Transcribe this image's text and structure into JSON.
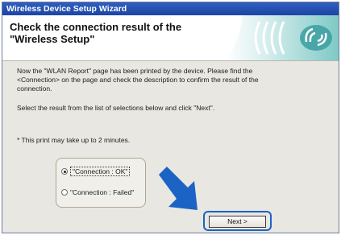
{
  "window": {
    "title": "Wireless Device Setup Wizard"
  },
  "header": {
    "title_line1": "Check the connection result of the",
    "title_line2": "\"Wireless Setup\""
  },
  "content": {
    "p1_line1": "Now the \"WLAN Report\" page has been printed by the device. Please find the",
    "p1_line2": "<Connection> on the page and check the description to confirm the result of the",
    "p1_line3": "connection.",
    "p2": "Select the result from the list of selections below and click \"Next\".",
    "note": "* This print may take up to 2 minutes."
  },
  "options": [
    {
      "label": "\"Connection : OK\"",
      "selected": true
    },
    {
      "label": "\"Connection : Failed\"",
      "selected": false
    }
  ],
  "buttons": {
    "next": "Next >"
  },
  "colors": {
    "titlebar": "#2453b3",
    "arrow": "#1b63c4",
    "accent_teal": "#2aa3a3"
  }
}
